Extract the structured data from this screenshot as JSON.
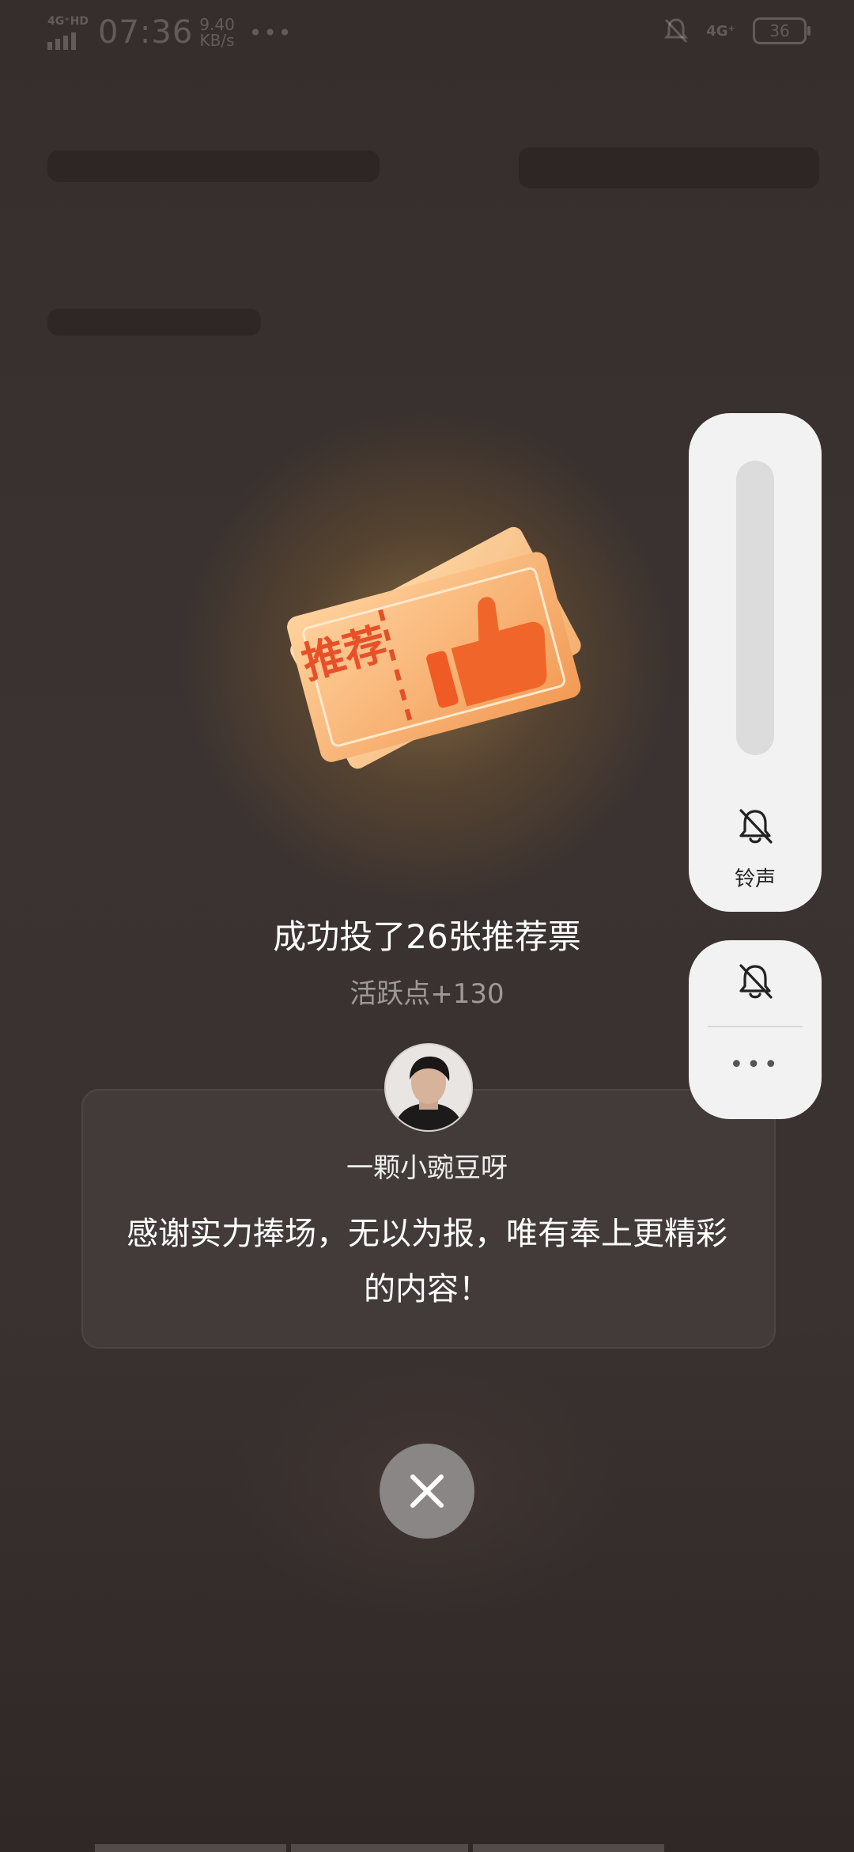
{
  "status_bar": {
    "network": "4G⁺HD",
    "time": "07:36",
    "speed_value": "9.40",
    "speed_unit": "KB/s",
    "more": "•••",
    "net_right": "4G⁺",
    "battery": "36"
  },
  "reward": {
    "ticket_text": "推荐",
    "headline": "成功投了26张推荐票",
    "activity": "活跃点+130"
  },
  "author_card": {
    "name": "一颗小豌豆呀",
    "message": "感谢实力捧场，无以为报，唯有奉上更精彩的内容！"
  },
  "close": {
    "icon": "close-icon"
  },
  "volume_panel": {
    "label": "铃声",
    "level": 0,
    "icon": "bell-muted-icon",
    "more": "•••"
  }
}
